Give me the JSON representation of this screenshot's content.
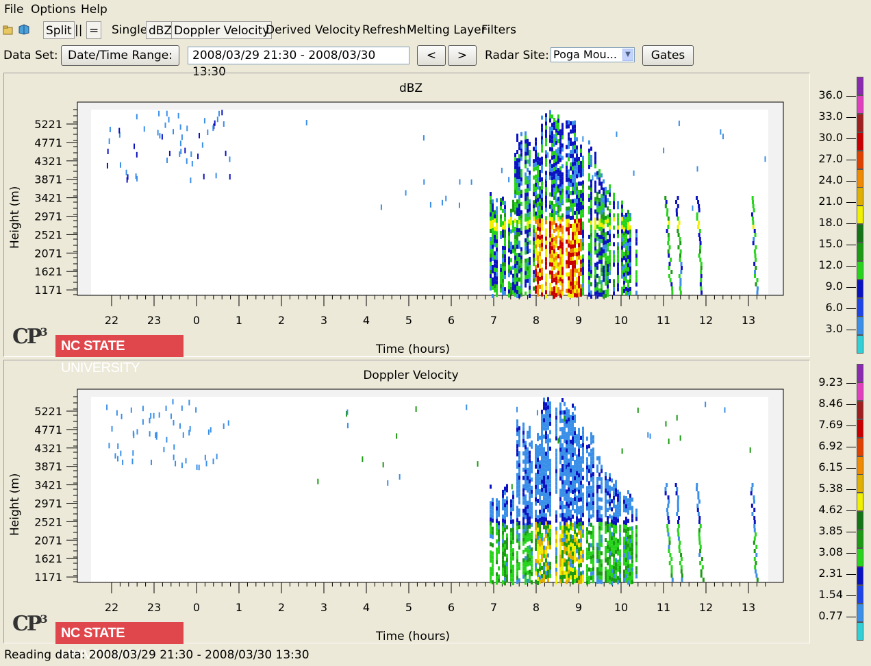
{
  "menu": [
    "File",
    "Options",
    "Help"
  ],
  "toolbar": {
    "split": "Split",
    "parallel": "||",
    "equal": "=",
    "single": "Single",
    "dbz": "dBZ",
    "doppler": "Doppler Velocity",
    "derived": "Derived Velocity",
    "refresh": "Refresh",
    "melting": "Melting Layer",
    "filters": "Filters"
  },
  "dataset": {
    "label": "Data Set:",
    "date_button": "Date/Time Range:",
    "range_value": "2008/03/29 21:30 - 2008/03/30 13:30",
    "prev": "<",
    "next": ">",
    "radar_label": "Radar Site:",
    "radar_value": "Poga Mou...",
    "gates": "Gates"
  },
  "colors": {
    "scale": [
      "#2fd0d6",
      "#3a8fe8",
      "#1f44e8",
      "#0b12c0",
      "#27d41c",
      "#1c9a14",
      "#167418",
      "#f0f000",
      "#e0b000",
      "#f08a00",
      "#e04000",
      "#c80000",
      "#a02020",
      "#e040c0",
      "#8a2ab0"
    ]
  },
  "panels": [
    {
      "title": "dBZ",
      "ylabel": "Height (m)",
      "xlabel": "Time (hours)",
      "yticks": [
        "5221",
        "4771",
        "4321",
        "3871",
        "3421",
        "2971",
        "2521",
        "2071",
        "1621",
        "1171"
      ],
      "xticks": [
        "22",
        "23",
        "0",
        "1",
        "2",
        "3",
        "4",
        "5",
        "6",
        "7",
        "8",
        "9",
        "10",
        "11",
        "12",
        "13"
      ],
      "colorbar_labels": [
        "36.0",
        "33.0",
        "30.0",
        "27.0",
        "24.0",
        "21.0",
        "18.0",
        "15.0",
        "12.0",
        "9.0",
        "6.0",
        "3.0"
      ]
    },
    {
      "title": "Doppler Velocity",
      "ylabel": "Height (m)",
      "xlabel": "Time (hours)",
      "yticks": [
        "5221",
        "4771",
        "4321",
        "3871",
        "3421",
        "2971",
        "2521",
        "2071",
        "1621",
        "1171"
      ],
      "xticks": [
        "22",
        "23",
        "0",
        "1",
        "2",
        "3",
        "4",
        "5",
        "6",
        "7",
        "8",
        "9",
        "10",
        "11",
        "12",
        "13"
      ],
      "colorbar_labels": [
        "9.23",
        "8.46",
        "7.69",
        "6.92",
        "6.15",
        "5.38",
        "4.62",
        "3.85",
        "3.08",
        "2.31",
        "1.54",
        "0.77"
      ]
    }
  ],
  "logo": {
    "cp": "CP",
    "cp_sup": "3",
    "ncsu_bold": "NC STATE",
    "ncsu_rest": " UNIVERSITY"
  },
  "status": "Reading data: 2008/03/29 21:30 - 2008/03/30 13:30"
}
